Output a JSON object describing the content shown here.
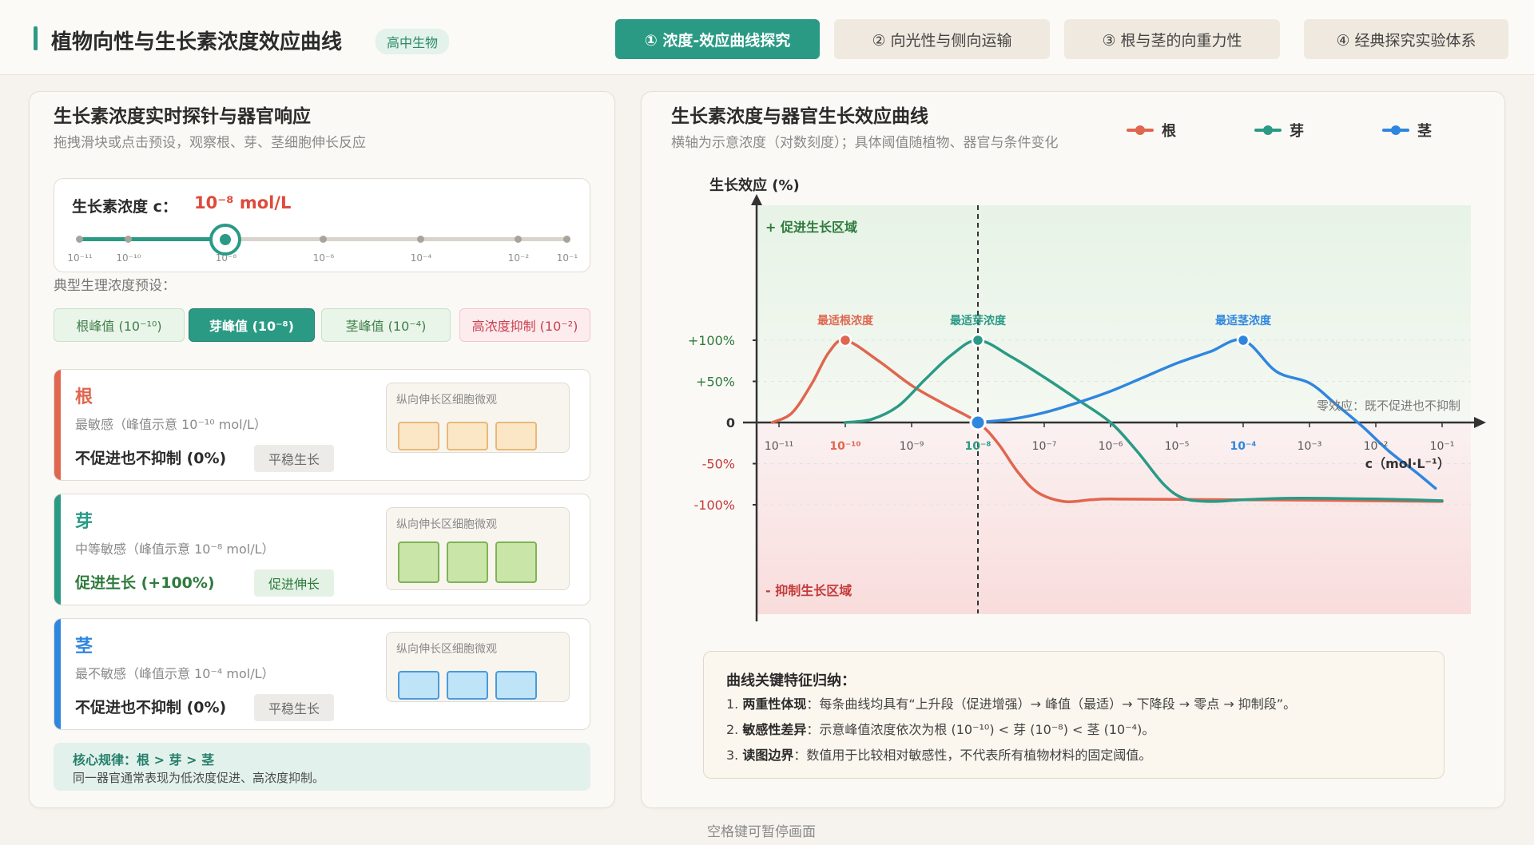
{
  "header": {
    "title": "植物向性与生长素浓度效应曲线",
    "badge": "高中生物",
    "tabs": [
      {
        "label": "① 浓度-效应曲线探究",
        "active": true
      },
      {
        "label": "② 向光性与侧向运输",
        "active": false
      },
      {
        "label": "③ 根与茎的向重力性",
        "active": false
      },
      {
        "label": "④ 经典探究实验体系",
        "active": false
      }
    ]
  },
  "left": {
    "title": "生长素浓度实时探针与器官响应",
    "subtitle": "拖拽滑块或点击预设，观察根、芽、茎细胞伸长反应",
    "probe": {
      "label": "生长素浓度 c：",
      "value": "10⁻⁸ mol/L",
      "ticks": [
        "10⁻¹¹",
        "10⁻¹⁰",
        "10⁻⁸",
        "10⁻⁶",
        "10⁻⁴",
        "10⁻²",
        "10⁻¹"
      ],
      "selected_index": 2
    },
    "preset_caption": "典型生理浓度预设：",
    "presets": [
      "根峰值 (10⁻¹⁰)",
      "芽峰值 (10⁻⁸)",
      "茎峰值 (10⁻⁴)",
      "高浓度抑制 (10⁻²)"
    ],
    "organs": [
      {
        "name": "根",
        "sensitivity": "最敏感（峰值示意 10⁻¹⁰ mol/L）",
        "effect": "不促进也不抑制 (0%)",
        "state": "平稳生长",
        "micro_title": "纵向伸长区细胞微观",
        "color": "#e0664f"
      },
      {
        "name": "芽",
        "sensitivity": "中等敏感（峰值示意 10⁻⁸ mol/L）",
        "effect": "促进生长 (+100%)",
        "state": "促进伸长",
        "micro_title": "纵向伸长区细胞微观",
        "color": "#2a9a85"
      },
      {
        "name": "茎",
        "sensitivity": "最不敏感（峰值示意 10⁻⁴ mol/L）",
        "effect": "不促进也不抑制 (0%)",
        "state": "平稳生长",
        "micro_title": "纵向伸长区细胞微观",
        "color": "#2f86df"
      }
    ],
    "rule_title": "核心规律：根 > 芽 > 茎",
    "rule_text": "同一器官通常表现为低浓度促进、高浓度抑制。"
  },
  "right": {
    "title": "生长素浓度与器官生长效应曲线",
    "subtitle": "横轴为示意浓度（对数刻度）；具体阈值随植物、器官与条件变化",
    "summary": {
      "title": "曲线关键特征归纳：",
      "items": [
        {
          "num": "1.",
          "head": "两重性体现",
          "text": "：每条曲线均具有“上升段（促进增强）→ 峰值（最适）→ 下降段 → 零点 → 抑制段”。"
        },
        {
          "num": "2.",
          "head": "敏感性差异",
          "text": "：示意峰值浓度依次为根 (10⁻¹⁰) < 芽 (10⁻⁸) < 茎 (10⁻⁴)。"
        },
        {
          "num": "3.",
          "head": "读图边界",
          "text": "：数值用于比较相对敏感性，不代表所有植物材料的固定阈值。"
        }
      ]
    }
  },
  "chart_data": {
    "type": "line",
    "title": "",
    "ylabel": "生长效应 (%)",
    "xlabel": "c（mol·L⁻¹）",
    "x_scale": "log",
    "x_ticks": [
      "10⁻¹¹",
      "10⁻¹⁰",
      "10⁻⁹",
      "10⁻⁸",
      "10⁻⁷",
      "10⁻⁶",
      "10⁻⁵",
      "10⁻⁴",
      "10⁻³",
      "10⁻²",
      "10⁻¹"
    ],
    "y_ticks": [
      "+100%",
      "+50%",
      "0",
      "-50%",
      "-100%"
    ],
    "ylim": [
      -115,
      130
    ],
    "xlim_exponent": [
      -11.5,
      -0.7
    ],
    "legend": [
      "根",
      "芽",
      "茎"
    ],
    "legend_position": "top-right",
    "region_labels": [
      "+ 促进生长区域",
      "- 抑制生长区域"
    ],
    "zero_label": "零效应：既不促进也不抑制",
    "probe_exponent": -8,
    "series": [
      {
        "name": "根",
        "color": "#e0664f",
        "peak_label": "最适根浓度",
        "peak": [
          -10,
          100
        ],
        "points": [
          [
            -11.1,
            0
          ],
          [
            -10.8,
            12
          ],
          [
            -10.5,
            48
          ],
          [
            -10.25,
            85
          ],
          [
            -10,
            100
          ],
          [
            -9.5,
            75
          ],
          [
            -9,
            45
          ],
          [
            -8.5,
            22
          ],
          [
            -8,
            0
          ],
          [
            -7.7,
            -25
          ],
          [
            -7.4,
            -60
          ],
          [
            -7.1,
            -85
          ],
          [
            -6.7,
            -96
          ],
          [
            -6.3,
            -94
          ],
          [
            -6.0,
            -93
          ],
          [
            -5,
            -93.5
          ],
          [
            -3,
            -94.5
          ],
          [
            -1.0,
            -96
          ]
        ]
      },
      {
        "name": "芽",
        "color": "#2a9a85",
        "peak_label": "最适芽浓度",
        "peak": [
          -8,
          100
        ],
        "points": [
          [
            -10,
            0
          ],
          [
            -9.6,
            4
          ],
          [
            -9.2,
            20
          ],
          [
            -8.8,
            52
          ],
          [
            -8.4,
            82
          ],
          [
            -8,
            100
          ],
          [
            -7.5,
            80
          ],
          [
            -7,
            55
          ],
          [
            -6.5,
            28
          ],
          [
            -6,
            0
          ],
          [
            -5.6,
            -35
          ],
          [
            -5.2,
            -75
          ],
          [
            -4.9,
            -92
          ],
          [
            -4.5,
            -96
          ],
          [
            -4,
            -94
          ],
          [
            -3.2,
            -92
          ],
          [
            -2,
            -93
          ],
          [
            -1.0,
            -95
          ]
        ]
      },
      {
        "name": "茎",
        "color": "#2f86df",
        "peak_label": "最适茎浓度",
        "peak": [
          -4,
          100
        ],
        "points": [
          [
            -8,
            0
          ],
          [
            -7.5,
            4
          ],
          [
            -7,
            12
          ],
          [
            -6.5,
            24
          ],
          [
            -6,
            38
          ],
          [
            -5.5,
            55
          ],
          [
            -5,
            72
          ],
          [
            -4.5,
            86
          ],
          [
            -4,
            100
          ],
          [
            -3.5,
            62
          ],
          [
            -3,
            48
          ],
          [
            -2.6,
            22
          ],
          [
            -2.2,
            -5
          ],
          [
            -1.8,
            -35
          ],
          [
            -1.4,
            -60
          ],
          [
            -1.1,
            -80
          ]
        ]
      }
    ]
  },
  "footer": "空格键可暂停画面"
}
